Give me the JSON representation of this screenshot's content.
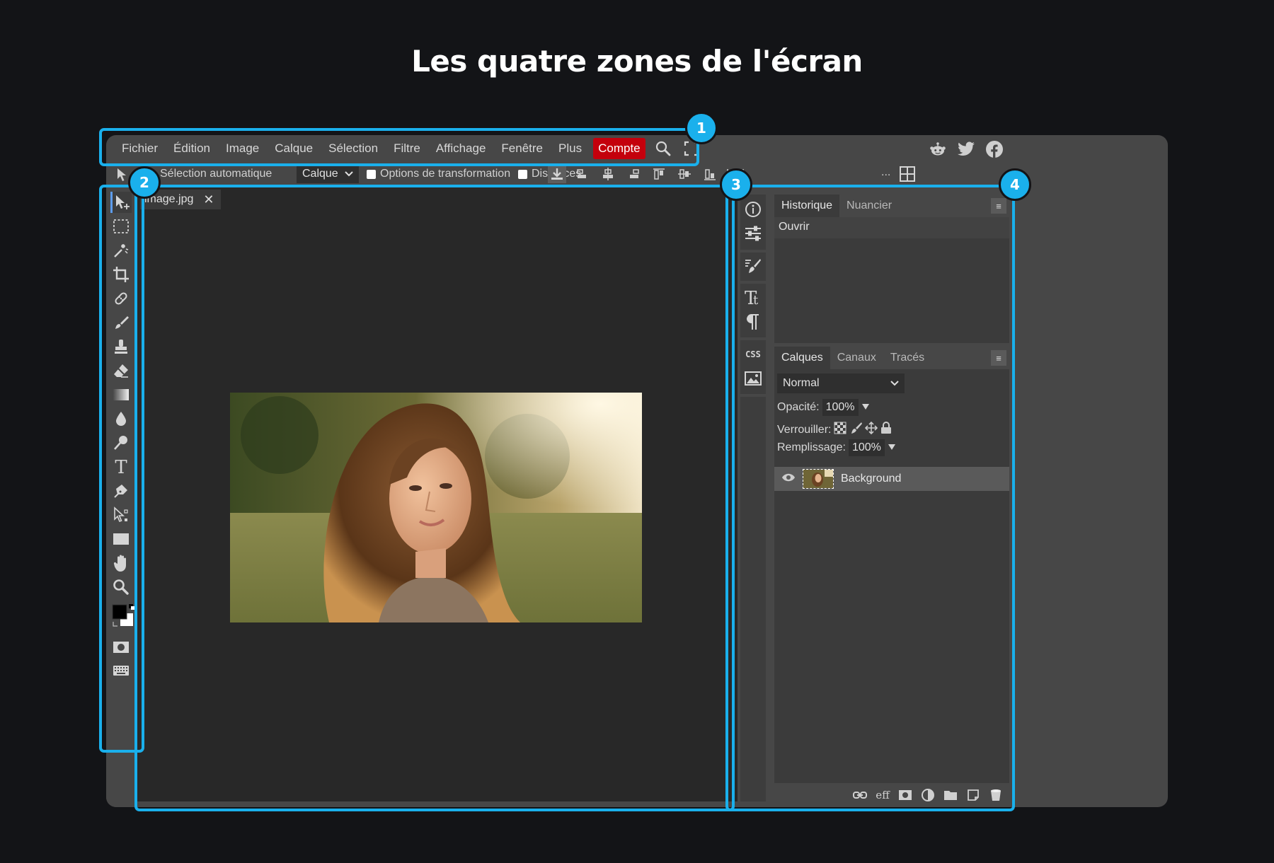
{
  "title": "Les quatre zones de l'écran",
  "menu": {
    "items": [
      "Fichier",
      "Édition",
      "Image",
      "Calque",
      "Sélection",
      "Filtre",
      "Affichage",
      "Fenêtre",
      "Plus"
    ],
    "account": "Compte",
    "icons": [
      "search-icon",
      "fullscreen-icon"
    ],
    "social_icons": [
      "reddit-icon",
      "twitter-icon",
      "facebook-icon"
    ]
  },
  "options_bar": {
    "auto_select_label": "Sélection automatique",
    "select_value": "Calque",
    "transform_label": "Options de transformation",
    "distances_label": "Distances",
    "more": "..."
  },
  "document": {
    "tab_name": "image.jpg",
    "close": "✕"
  },
  "history_panel": {
    "tabs": [
      "Historique",
      "Nuancier"
    ],
    "menu_icon": "≡",
    "rows": [
      "Ouvrir"
    ]
  },
  "layers_panel": {
    "tabs": [
      "Calques",
      "Canaux",
      "Tracés"
    ],
    "menu_icon": "≡",
    "blend_mode": "Normal",
    "opacity_label": "Opacité:",
    "opacity_value": "100%",
    "lock_label": "Verrouiller:",
    "fill_label": "Remplissage:",
    "fill_value": "100%",
    "layer_name": "Background",
    "footer_effects": "eff"
  },
  "icon_bar": {
    "css_label": "CSS"
  },
  "zones": [
    "1",
    "2",
    "3",
    "4"
  ],
  "colors": {
    "zone_outline": "#1ab0ec",
    "account_button": "#c4000c",
    "page_background": "#131417"
  }
}
